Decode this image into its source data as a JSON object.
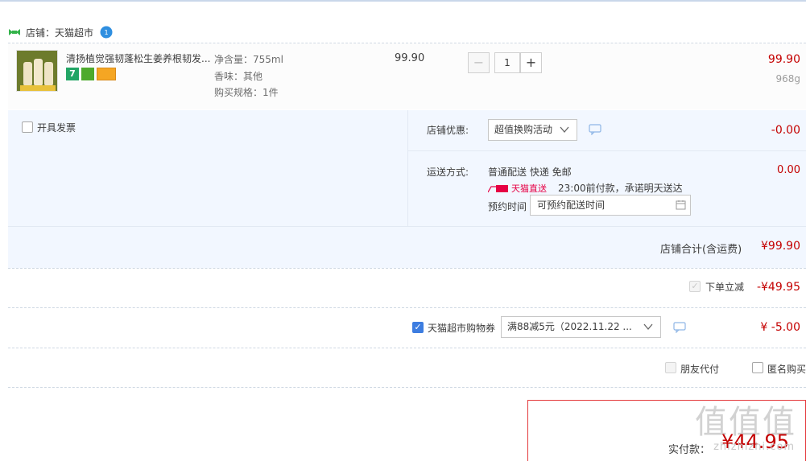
{
  "shop": {
    "label": "店铺：天猫超市"
  },
  "item": {
    "title": "清扬植觉强韧蓬松生姜养根韧发...",
    "badge_seven": "7",
    "specs": [
      "净含量：755ml",
      "香味：其他",
      "购买规格：1件"
    ],
    "unit_price": "99.90",
    "quantity": "1",
    "minus": "−",
    "plus": "+",
    "sum_price": "99.90",
    "weight": "968g"
  },
  "invoice": {
    "label": "开具发票"
  },
  "shop_discount": {
    "label": "店铺优惠:",
    "selected": "超值换购活动",
    "value": "-0.00"
  },
  "shipping": {
    "label": "运送方式:",
    "method": "普通配送 快递 免邮",
    "tmall_tag": "天猫直送",
    "promise": "23:00前付款，承诺明天送达",
    "schedule_label": "预约时间",
    "schedule_placeholder": "可预约配送时间",
    "value": "0.00"
  },
  "shop_total": {
    "label": "店铺合计(含运费)",
    "value": "¥99.90"
  },
  "instant_discount": {
    "label": "下单立减",
    "value": "-¥49.95"
  },
  "coupon": {
    "label": "天猫超市购物券",
    "selected": "满88减5元（2022.11.22 ...",
    "value": "¥ -5.00"
  },
  "options": {
    "friend_pay": "朋友代付",
    "anonymous": "匿名购买"
  },
  "final": {
    "label": "实付款：",
    "value": "¥44.95"
  },
  "watermark": {
    "text": "值值值",
    "site": "zhizhizhi.com"
  },
  "colors": {
    "accent_red": "#c40000",
    "panel_bg": "#f2f7ff",
    "check_blue": "#3d7de0"
  }
}
